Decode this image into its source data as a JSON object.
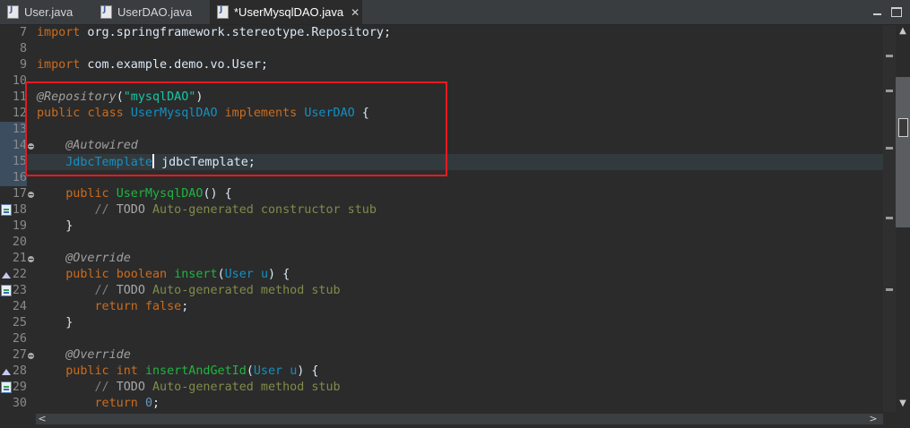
{
  "tabs": [
    {
      "label": "User.java",
      "active": false,
      "icon": "java-file-icon"
    },
    {
      "label": "UserDAO.java",
      "active": false,
      "icon": "java-file-icon"
    },
    {
      "label": "*UserMysqlDAO.java",
      "active": true,
      "icon": "java-file-icon",
      "close": "✕"
    }
  ],
  "colors": {
    "editor_background": "#2b2b2b",
    "keyword": "#cc6c1d",
    "annotation": "#a0a0a0",
    "string": "#17c6a3",
    "type": "#1290c3",
    "method": "#1eb540",
    "highlight_box": "#e8191f"
  },
  "editor": {
    "lines": [
      {
        "n": "7",
        "t1": "import",
        "t2": " org.springframework.stereotype.Repository;"
      },
      {
        "n": "8"
      },
      {
        "n": "9",
        "t1": "import",
        "t2": " com.example.demo.vo.User;"
      },
      {
        "n": "10"
      },
      {
        "n": "11",
        "t1": "@Repository",
        "t2": "(",
        "t3": "\"mysqlDAO\"",
        "t4": ")"
      },
      {
        "n": "12",
        "t1": "public",
        "t2": " ",
        "t3": "class",
        "t4": " ",
        "t5": "UserMysqlDAO",
        "t6": " ",
        "t7": "implements",
        "t8": " ",
        "t9": "UserDAO",
        "t10": " {"
      },
      {
        "n": "13"
      },
      {
        "n": "14",
        "t1": "    ",
        "t2": "@Autowired"
      },
      {
        "n": "15",
        "t1": "    ",
        "t2": "JdbcTemplate",
        "t3": " ",
        "t4": "jdbcTemplate;"
      },
      {
        "n": "16"
      },
      {
        "n": "17",
        "t1": "    ",
        "t2": "public",
        "t3": " ",
        "t4": "UserMysqlDAO",
        "t5": "() {"
      },
      {
        "n": "18",
        "t1": "        ",
        "t2": "// ",
        "t3": "TODO",
        "t4": " Auto-generated constructor stub"
      },
      {
        "n": "19",
        "t1": "    }"
      },
      {
        "n": "20"
      },
      {
        "n": "21",
        "t1": "    ",
        "t2": "@Override"
      },
      {
        "n": "22",
        "t1": "    ",
        "t2": "public",
        "t3": " ",
        "t4": "boolean",
        "t5": " ",
        "t6": "insert",
        "t7": "(",
        "t8": "User",
        "t9": " ",
        "t10": "u",
        "t11": ") {"
      },
      {
        "n": "23",
        "t1": "        ",
        "t2": "// ",
        "t3": "TODO",
        "t4": " Auto-generated method stub"
      },
      {
        "n": "24",
        "t1": "        ",
        "t2": "return",
        "t3": " ",
        "t4": "false",
        "t5": ";"
      },
      {
        "n": "25",
        "t1": "    }"
      },
      {
        "n": "26"
      },
      {
        "n": "27",
        "t1": "    ",
        "t2": "@Override"
      },
      {
        "n": "28",
        "t1": "    ",
        "t2": "public",
        "t3": " ",
        "t4": "int",
        "t5": " ",
        "t6": "insertAndGetId",
        "t7": "(",
        "t8": "User",
        "t9": " ",
        "t10": "u",
        "t11": ") {"
      },
      {
        "n": "29",
        "t1": "        ",
        "t2": "// ",
        "t3": "TODO",
        "t4": " Auto-generated method stub"
      },
      {
        "n": "30",
        "t1": "        ",
        "t2": "return",
        "t3": " ",
        "t4": "0",
        "t5": ";"
      }
    ]
  },
  "scrollbars": {
    "up_arrow": "▲",
    "down_arrow": "▼",
    "left_arrow": "<",
    "right_arrow": ">"
  }
}
